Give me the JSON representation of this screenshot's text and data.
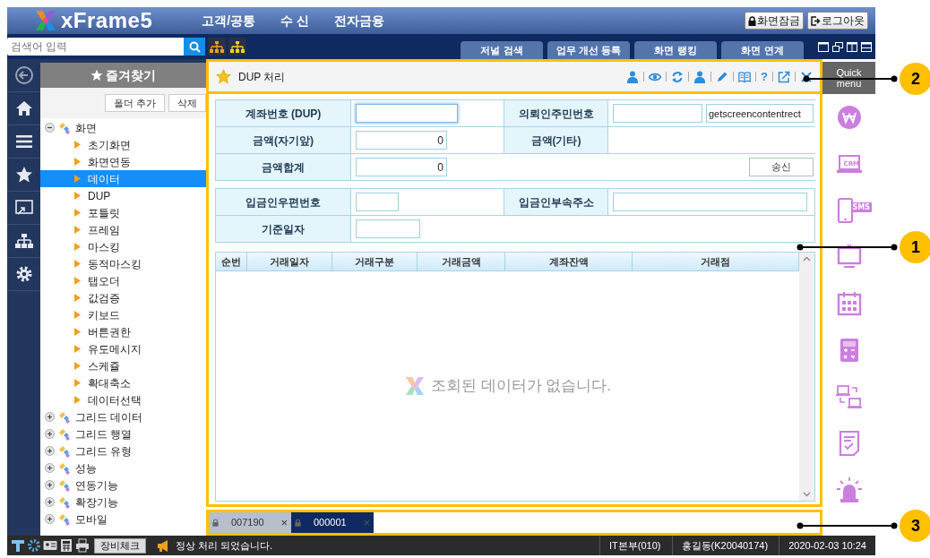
{
  "header": {
    "logo": "xFrame5",
    "menu": [
      "고객/공통",
      "수 신",
      "전자금융"
    ],
    "buttons": [
      {
        "kind": "lock",
        "label": "화면잠금"
      },
      {
        "kind": "logout",
        "label": "로그아웃"
      }
    ]
  },
  "toolbar": {
    "search": {
      "placeholder": "검색어 입력"
    },
    "tabs": [
      "저널 검색",
      "업무 개선 등록",
      "화면 랭킹",
      "화면 연계"
    ]
  },
  "favorites": {
    "title": "즐겨찾기",
    "buttons": [
      "폴더 추가",
      "삭제"
    ],
    "tree": [
      {
        "label": "화면",
        "expanded": true,
        "selected": false,
        "children": [
          {
            "label": "초기화면",
            "selected": false
          },
          {
            "label": "화면연동",
            "selected": false
          },
          {
            "label": "데이터",
            "selected": true
          },
          {
            "label": "DUP",
            "selected": false
          },
          {
            "label": "포틀릿",
            "selected": false
          },
          {
            "label": "프레임",
            "selected": false
          },
          {
            "label": "마스킹",
            "selected": false
          },
          {
            "label": "동적마스킹",
            "selected": false
          },
          {
            "label": "탭오더",
            "selected": false
          },
          {
            "label": "값검증",
            "selected": false
          },
          {
            "label": "키보드",
            "selected": false
          },
          {
            "label": "버튼권한",
            "selected": false
          },
          {
            "label": "유도메시지",
            "selected": false
          },
          {
            "label": "스케쥴",
            "selected": false
          },
          {
            "label": "확대축소",
            "selected": false
          },
          {
            "label": "데이터선택",
            "selected": false
          }
        ]
      },
      {
        "label": "그리드 데이터",
        "expanded": false,
        "selected": false
      },
      {
        "label": "그리드 행열",
        "expanded": false,
        "selected": false
      },
      {
        "label": "그리드 유형",
        "expanded": false,
        "selected": false
      },
      {
        "label": "성능",
        "expanded": false,
        "selected": false
      },
      {
        "label": "연동기능",
        "expanded": false,
        "selected": false
      },
      {
        "label": "확장기능",
        "expanded": false,
        "selected": false
      },
      {
        "label": "모바일",
        "expanded": false,
        "selected": false
      }
    ]
  },
  "screen": {
    "title": "DUP 처리",
    "help": "?",
    "forms": [
      {
        "rows": [
          {
            "cells": [
              {
                "label": "계좌번호 (DUP)",
                "controls": [
                  {
                    "kind": "text",
                    "focused": true
                  }
                ]
              },
              {
                "label": "의뢰인주민번호",
                "controls": [
                  {
                    "kind": "text",
                    "focused": false
                  },
                  {
                    "kind": "text",
                    "value": "getscreencontentrect",
                    "focused": false
                  }
                ]
              }
            ]
          },
          {
            "cells": [
              {
                "label": "금액(자기앞)",
                "controls": [
                  {
                    "kind": "number",
                    "value": "0",
                    "focused": false
                  }
                ]
              },
              {
                "label": "금액(기타)"
              }
            ]
          },
          {
            "cells": [
              {
                "label": "금액합계",
                "controls": [
                  {
                    "kind": "number",
                    "value": "0",
                    "focused": false
                  },
                  {
                    "kind": "button",
                    "label": "송신"
                  }
                ]
              }
            ]
          }
        ]
      },
      {
        "rows": [
          {
            "cells": [
              {
                "label": "입금인우편번호",
                "controls": [
                  {
                    "kind": "text",
                    "focused": false
                  }
                ]
              },
              {
                "label": "입금인부속주소",
                "controls": [
                  {
                    "kind": "text",
                    "focused": false
                  }
                ]
              }
            ]
          },
          {
            "cells": [
              {
                "label": "기준일자",
                "controls": [
                  {
                    "kind": "text",
                    "focused": false
                  }
                ]
              }
            ]
          }
        ]
      }
    ],
    "grid": {
      "columns": [
        "순번",
        "거래일자",
        "거래구분",
        "거래금액",
        "계좌잔액",
        "거래점"
      ],
      "empty_message": "조회된 데이터가 없습니다."
    }
  },
  "screen_tabs": [
    {
      "label": "007190",
      "close": "×",
      "selected": false
    },
    {
      "label": "000001",
      "close": "×",
      "selected": true
    }
  ],
  "quick_menu": {
    "title": "Quick menu",
    "items": [
      {
        "kind": "won"
      },
      {
        "kind": "crm",
        "text": "CRM"
      },
      {
        "kind": "sms",
        "text": "SMS"
      },
      {
        "kind": "monitor"
      },
      {
        "kind": "calendar"
      },
      {
        "kind": "calculator"
      },
      {
        "kind": "network"
      },
      {
        "kind": "checklist"
      },
      {
        "kind": "alarm"
      }
    ]
  },
  "status_bar": {
    "button": "장비체크",
    "message": "정상 처리 되었습니다.",
    "department": "IT본부(010)",
    "user": "홍길동(K20040174)",
    "datetime": "2020-02-03 10:24"
  },
  "callouts": [
    {
      "number": "2"
    },
    {
      "number": "1"
    },
    {
      "number": "3"
    }
  ]
}
